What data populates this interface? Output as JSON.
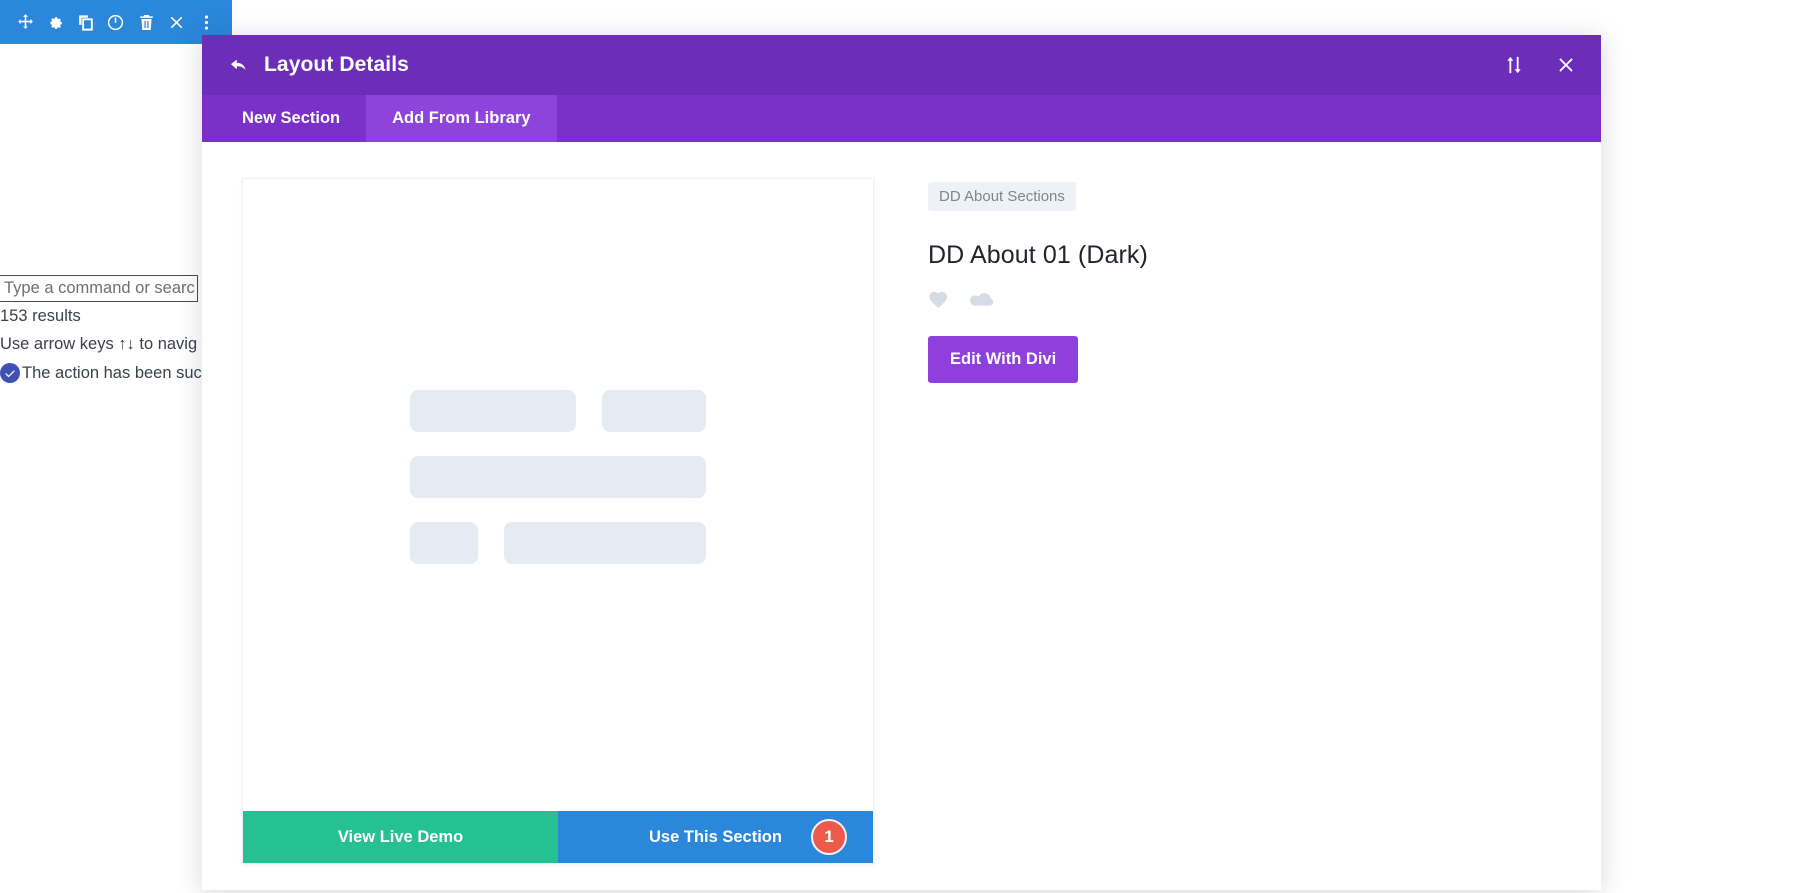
{
  "divi_toolbar": {
    "icons": [
      {
        "name": "move-icon",
        "title": "Move"
      },
      {
        "name": "gear-icon",
        "title": "Settings"
      },
      {
        "name": "duplicate-icon",
        "title": "Duplicate"
      },
      {
        "name": "power-toggle-icon",
        "title": "Disable"
      },
      {
        "name": "trash-icon",
        "title": "Delete"
      },
      {
        "name": "close-icon",
        "title": "Close"
      },
      {
        "name": "more-options-icon",
        "title": "More options"
      }
    ]
  },
  "background_panel": {
    "search_placeholder": "Type a command or searc",
    "results_count": "153 results",
    "navigation_hint": "Use arrow keys ↑↓ to navig",
    "toast_message": "The action has been suc"
  },
  "modal": {
    "title": "Layout Details",
    "back_icon": "back-arrow-icon",
    "header_icons": [
      {
        "name": "sort-toggle-icon",
        "label": "Sort"
      },
      {
        "name": "close-icon",
        "label": "Close"
      }
    ],
    "tabs": [
      {
        "label": "New Section",
        "active": false
      },
      {
        "label": "Add From Library",
        "active": true
      }
    ],
    "preview": {
      "view_demo_label": "View Live Demo",
      "use_section_label": "Use This Section",
      "badge_count": "1"
    },
    "details": {
      "category": "DD About Sections",
      "title": "DD About 01 (Dark)",
      "meta_icons": [
        {
          "name": "heart-icon",
          "label": "Favorite"
        },
        {
          "name": "cloud-icon",
          "label": "Cloud"
        }
      ],
      "edit_button_label": "Edit With Divi"
    }
  },
  "colors": {
    "toolbar_blue": "#2b87da",
    "modal_header_purple": "#6c2eb9",
    "tabbar_purple": "#7b31c9",
    "tab_active_purple": "#8d43dc",
    "edit_button_purple": "#8e3fdc",
    "demo_green": "#25c193",
    "use_blue": "#2b87da",
    "badge_red": "#ed5a4b",
    "skeleton_gray": "#e6ebf3",
    "category_badge_bg": "#eef1f6"
  }
}
